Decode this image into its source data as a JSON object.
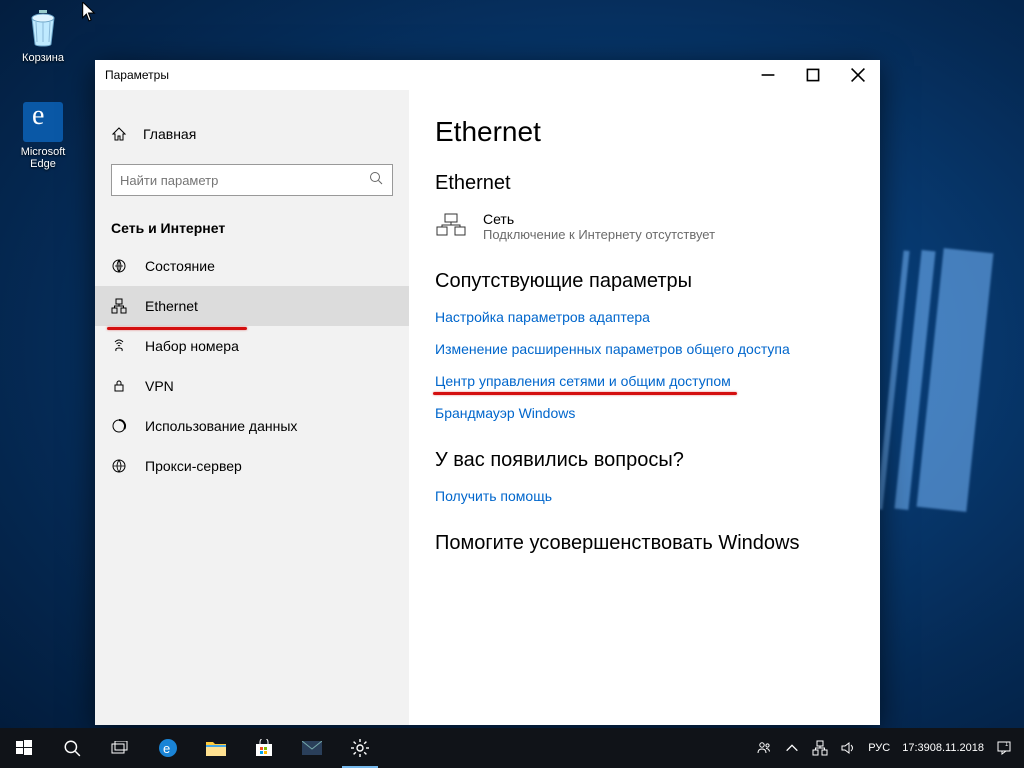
{
  "desktop": {
    "recycle": "Корзина",
    "edge": "Microsoft Edge"
  },
  "window": {
    "title": "Параметры",
    "home": "Главная",
    "search_placeholder": "Найти параметр",
    "section": "Сеть и Интернет",
    "nav": {
      "status": "Состояние",
      "ethernet": "Ethernet",
      "dialup": "Набор номера",
      "vpn": "VPN",
      "datausage": "Использование данных",
      "proxy": "Прокси-сервер"
    },
    "content": {
      "h1": "Ethernet",
      "h2_ethernet": "Ethernet",
      "net_name": "Сеть",
      "net_status": "Подключение к Интернету отсутствует",
      "h2_related": "Сопутствующие параметры",
      "links": {
        "adapter": "Настройка параметров адаптера",
        "sharing": "Изменение расширенных параметров общего доступа",
        "center": "Центр управления сетями и общим доступом",
        "firewall": "Брандмауэр Windows"
      },
      "h2_question": "У вас появились вопросы?",
      "help_link": "Получить помощь",
      "h2_improve": "Помогите усовершенствовать Windows"
    }
  },
  "tray": {
    "lang": "РУС",
    "time": "17:39",
    "date": "08.11.2018"
  }
}
